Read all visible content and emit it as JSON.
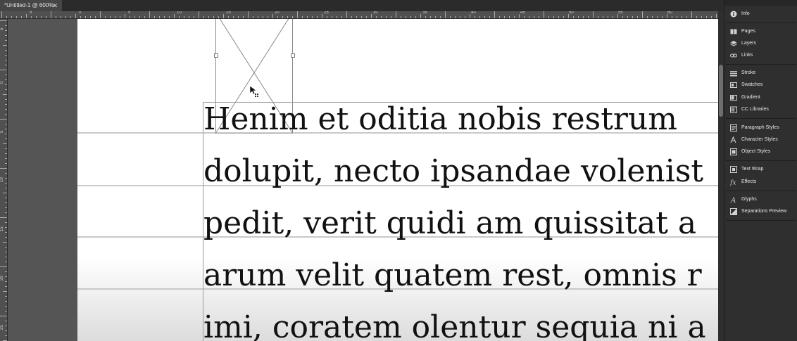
{
  "document": {
    "tab_title": "*Untitled-1 @ 600%",
    "close_glyph": "✕",
    "collapse_glyph": "«"
  },
  "ruler": {
    "horizontal_labels": [
      "5",
      "0",
      "5",
      "10",
      "15",
      "20",
      "25",
      "30",
      "35",
      "40",
      "45",
      "50",
      "55",
      "60"
    ],
    "vertical_labels": [
      "5",
      "0",
      "5",
      "10",
      "15",
      "20",
      "25"
    ]
  },
  "text_frame": {
    "lines": [
      "Henim et oditia nobis restrum",
      "dolupit, necto ipsandae volenist",
      "pedit, verit quidi am quissitat a",
      "arum velit quatem rest, omnis r",
      "imi, coratem olentur sequia ni a"
    ]
  },
  "panels": {
    "items": [
      {
        "label": "Info",
        "icon": "info-icon"
      },
      {
        "label": "Pages",
        "icon": "pages-icon"
      },
      {
        "label": "Layers",
        "icon": "layers-icon"
      },
      {
        "label": "Links",
        "icon": "links-icon"
      },
      {
        "label": "Stroke",
        "icon": "stroke-icon"
      },
      {
        "label": "Swatches",
        "icon": "swatches-icon"
      },
      {
        "label": "Gradient",
        "icon": "gradient-icon"
      },
      {
        "label": "CC Libraries",
        "icon": "cc-libraries-icon"
      },
      {
        "label": "Paragraph Styles",
        "icon": "paragraph-styles-icon"
      },
      {
        "label": "Character Styles",
        "icon": "character-styles-icon"
      },
      {
        "label": "Object Styles",
        "icon": "object-styles-icon"
      },
      {
        "label": "Text Wrap",
        "icon": "text-wrap-icon"
      },
      {
        "label": "Effects",
        "icon": "effects-icon"
      },
      {
        "label": "Glyphs",
        "icon": "glyphs-icon"
      },
      {
        "label": "Separations Preview",
        "icon": "separations-preview-icon"
      }
    ]
  },
  "colors": {
    "pasteboard": "#555555",
    "panel_bg": "#2f2f2f",
    "page": "#ffffff"
  }
}
